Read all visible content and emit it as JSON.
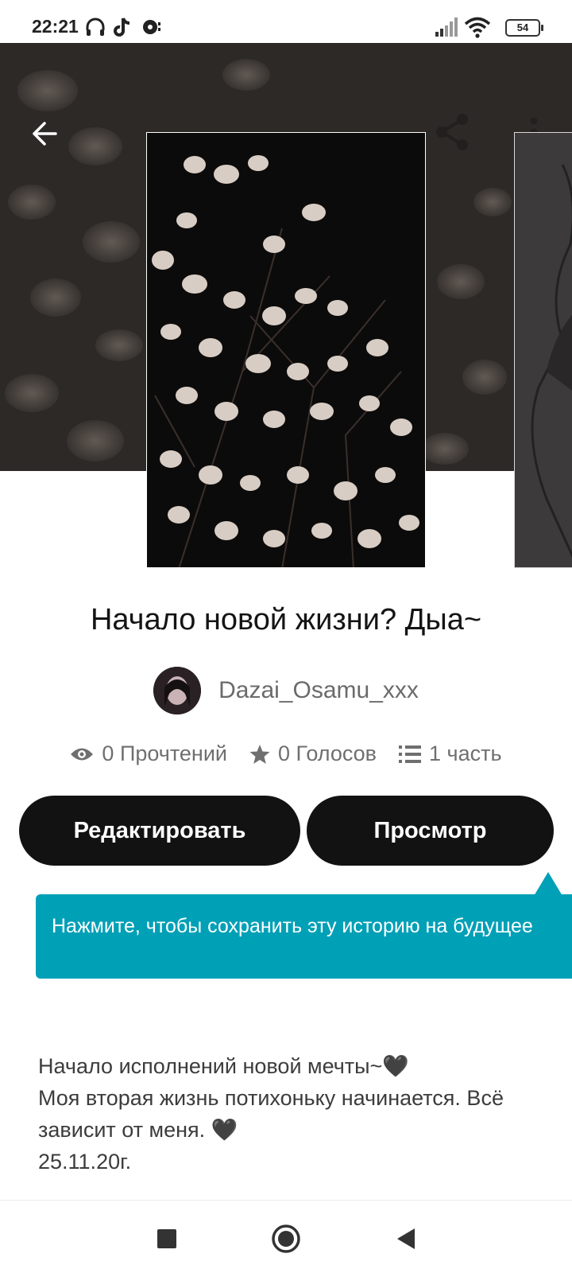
{
  "status_bar": {
    "time": "22:21",
    "battery": "54",
    "icons": [
      "headphones-icon",
      "tiktok-icon",
      "music-note-icon",
      "signal-icon",
      "wifi-icon",
      "battery-icon"
    ]
  },
  "header": {
    "back_icon": "arrow-left-icon",
    "share_icon": "share-icon",
    "more_icon": "more-vertical-icon"
  },
  "story": {
    "title": "Начало новой жизни? Дыа~",
    "author": "Dazai_Osamu_xxx",
    "stats": {
      "reads": "0 Прочтений",
      "votes": "0 Голосов",
      "parts": "1 часть"
    }
  },
  "actions": {
    "edit_label": "Редактировать",
    "view_label": "Просмотр"
  },
  "tooltip": {
    "text": "Нажмите, чтобы сохранить эту историю на будущее"
  },
  "description": {
    "lines": [
      "Начало исполнений новой мечты~🖤",
      "Моя вторая жизнь потихоньку начинается. Всё зависит от меня. 🖤",
      "25.11.20г."
    ]
  },
  "colors": {
    "button_bg": "#121212",
    "tooltip_bg": "#00a0b7",
    "hero_bg": "#2b2827"
  }
}
